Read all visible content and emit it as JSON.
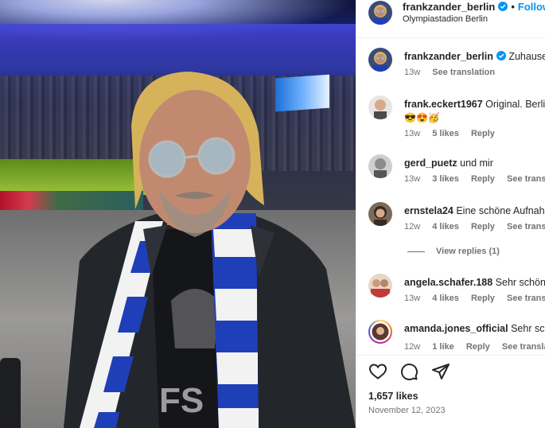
{
  "post": {
    "author": "frankzander_berlin",
    "follow_label": "Follow",
    "separator": "•",
    "location": "Olympiastadion Berlin",
    "photo_alt": "Man with round sunglasses and blue-white scarf in a stadium"
  },
  "comments": [
    {
      "user": "frankzander_berlin",
      "verified": true,
      "text": "Zuhause..",
      "emoji": "",
      "time": "13w",
      "likes": "",
      "reply": "",
      "translate": "See translation"
    },
    {
      "user": "frank.eckert1967",
      "verified": false,
      "text": "Original. Berlin",
      "emoji": "😎😍🥳",
      "time": "13w",
      "likes": "5 likes",
      "reply": "Reply",
      "translate": ""
    },
    {
      "user": "gerd_puetz",
      "verified": false,
      "text": "und mir",
      "emoji": "",
      "time": "13w",
      "likes": "3 likes",
      "reply": "Reply",
      "translate": "See translation"
    },
    {
      "user": "ernstela24",
      "verified": false,
      "text": "Eine schöne Aufnahme",
      "emoji": "",
      "time": "12w",
      "likes": "4 likes",
      "reply": "Reply",
      "translate": "See translation"
    },
    {
      "user": "angela.schafer.188",
      "verified": false,
      "text": "Sehr schönes",
      "emoji": "",
      "time": "13w",
      "likes": "4 likes",
      "reply": "Reply",
      "translate": "See translation"
    },
    {
      "user": "amanda.jones_official",
      "verified": false,
      "text": "Sehr schön",
      "emoji": "",
      "time": "12w",
      "likes": "1 like",
      "reply": "Reply",
      "translate": "See translation"
    }
  ],
  "view_replies": "View replies (1)",
  "actions": {
    "like_icon": "heart-icon",
    "comment_icon": "comment-icon",
    "share_icon": "share-icon"
  },
  "likes_count": "1,657 likes",
  "date": "November 12, 2023",
  "colors": {
    "link_blue": "#0095f6",
    "verified_blue": "#0095f6",
    "muted": "#737373"
  }
}
